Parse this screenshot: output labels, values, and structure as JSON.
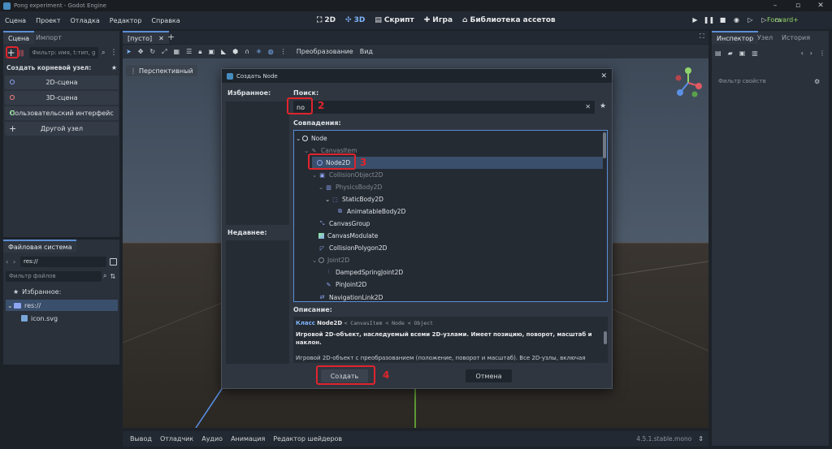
{
  "window": {
    "title": "Pong experiment - Godot Engine"
  },
  "menu": {
    "items": [
      "Сцена",
      "Проект",
      "Отладка",
      "Редактор",
      "Справка"
    ]
  },
  "modes": {
    "m2d": "2D",
    "m3d": "3D",
    "script": "Скрипт",
    "game": "Игра",
    "assets": "Библиотека ассетов"
  },
  "renderer": "Forward+",
  "scene_panel": {
    "tab_scene": "Сцена",
    "tab_import": "Импорт",
    "filter_placeholder": "Фильтр: имя, t:тип, g",
    "create_root": "Создать корневой узел:",
    "items": [
      "2D-сцена",
      "3D-сцена",
      "Пользовательский интерфейс",
      "Другой узел"
    ]
  },
  "fs_panel": {
    "title": "Файловая система",
    "path": "res://",
    "filter_placeholder": "Фильтр файлов",
    "favorites": "Избранное:",
    "root": "res://",
    "file": "icon.svg"
  },
  "viewport": {
    "tab": "[пусто]",
    "perspective": "Перспективный",
    "transform": "Преобразование",
    "view": "Вид"
  },
  "inspector": {
    "tab_inspector": "Инспектор",
    "tab_node": "Узел",
    "tab_history": "История",
    "filter_placeholder": "Фильтр свойств"
  },
  "dialog": {
    "title": "Создать Node",
    "favorites": "Избранное:",
    "recent": "Недавнее:",
    "search_label": "Поиск:",
    "search_value": "no",
    "matches_label": "Совпадения:",
    "tree": [
      {
        "label": "Node",
        "dim": false
      },
      {
        "label": "CanvasItem",
        "dim": true
      },
      {
        "label": "Node2D",
        "dim": false
      },
      {
        "label": "CollisionObject2D",
        "dim": true
      },
      {
        "label": "PhysicsBody2D",
        "dim": true
      },
      {
        "label": "StaticBody2D",
        "dim": false
      },
      {
        "label": "AnimatableBody2D",
        "dim": false
      },
      {
        "label": "CanvasGroup",
        "dim": false
      },
      {
        "label": "CanvasModulate",
        "dim": false
      },
      {
        "label": "CollisionPolygon2D",
        "dim": false
      },
      {
        "label": "Joint2D",
        "dim": true
      },
      {
        "label": "DampedSpringJoint2D",
        "dim": false
      },
      {
        "label": "PinJoint2D",
        "dim": false
      },
      {
        "label": "NavigationLink2D",
        "dim": false
      }
    ],
    "description_label": "Описание:",
    "desc_class_word": "Класс",
    "desc_class": "Node2D",
    "desc_chain": "< CanvasItem < Node < Object",
    "desc_bold": "Игровой 2D-объект, наследуемый всеми 2D-узлами. Имеет позицию, поворот, масштаб и наклон.",
    "desc_text": "Игровой 2D-объект с преобразованием (положение, поворот и масштаб). Все 2D-узлы, включая",
    "create": "Создать",
    "cancel": "Отмена"
  },
  "annotations": {
    "n2": "2",
    "n3": "3",
    "n4": "4"
  },
  "bottom": {
    "items": [
      "Вывод",
      "Отладчик",
      "Аудио",
      "Анимация",
      "Редактор шейдеров"
    ],
    "version": "4.5.1.stable.mono"
  },
  "colors": {
    "accent": "#5b8ed6",
    "annotation": "#e0242c",
    "renderer": "#8fd46a"
  }
}
